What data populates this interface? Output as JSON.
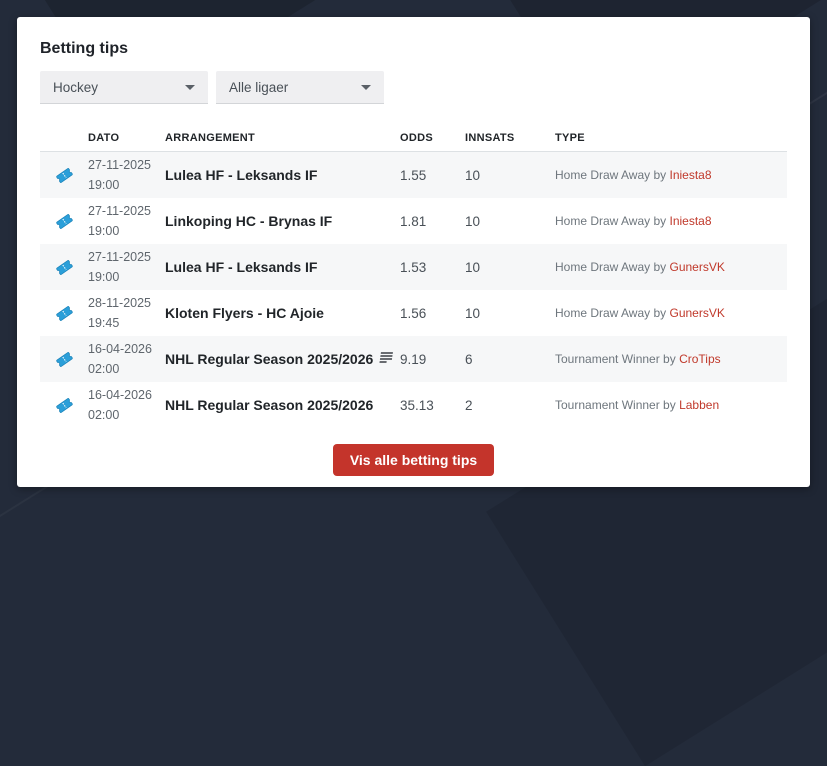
{
  "card": {
    "title": "Betting tips"
  },
  "filters": {
    "sport": {
      "value": "Hockey"
    },
    "league": {
      "value": "Alle ligaer"
    }
  },
  "table": {
    "headers": [
      "DATO",
      "ARRANGEMENT",
      "ODDS",
      "INNSATS",
      "TYPE"
    ],
    "rows": [
      {
        "date": "27-11-2025",
        "time": "19:00",
        "arrangement": "Lulea HF - Leksands IF",
        "odds": "1.55",
        "innsats": "10",
        "type_prefix": "Home Draw Away by",
        "tipster": "Iniesta8"
      },
      {
        "date": "27-11-2025",
        "time": "19:00",
        "arrangement": "Linkoping HC - Brynas IF",
        "odds": "1.81",
        "innsats": "10",
        "type_prefix": "Home Draw Away by",
        "tipster": "Iniesta8"
      },
      {
        "date": "27-11-2025",
        "time": "19:00",
        "arrangement": "Lulea HF - Leksands IF",
        "odds": "1.53",
        "innsats": "10",
        "type_prefix": "Home Draw Away by",
        "tipster": "GunersVK"
      },
      {
        "date": "28-11-2025",
        "time": "19:45",
        "arrangement": "Kloten Flyers - HC Ajoie",
        "odds": "1.56",
        "innsats": "10",
        "type_prefix": "Home Draw Away by",
        "tipster": "GunersVK"
      },
      {
        "date": "16-04-2026",
        "time": "02:00",
        "arrangement": "NHL Regular Season 2025/2026",
        "odds": "9.19",
        "innsats": "6",
        "type_prefix": "Tournament Winner by",
        "tipster": "CroTips"
      },
      {
        "date": "16-04-2026",
        "time": "02:00",
        "arrangement": "NHL Regular Season 2025/2026",
        "odds": "35.13",
        "innsats": "2",
        "type_prefix": "Tournament Winner by",
        "tipster": "Labben"
      }
    ]
  },
  "footer": {
    "show_all_label": "Vis alle betting tips"
  },
  "colors": {
    "page_background": "#232b3a",
    "accent_red": "#c4342b",
    "link_red": "#c0392b",
    "ticket_blue": "#2b9fd9",
    "row_stripe": "#f6f7f8"
  }
}
